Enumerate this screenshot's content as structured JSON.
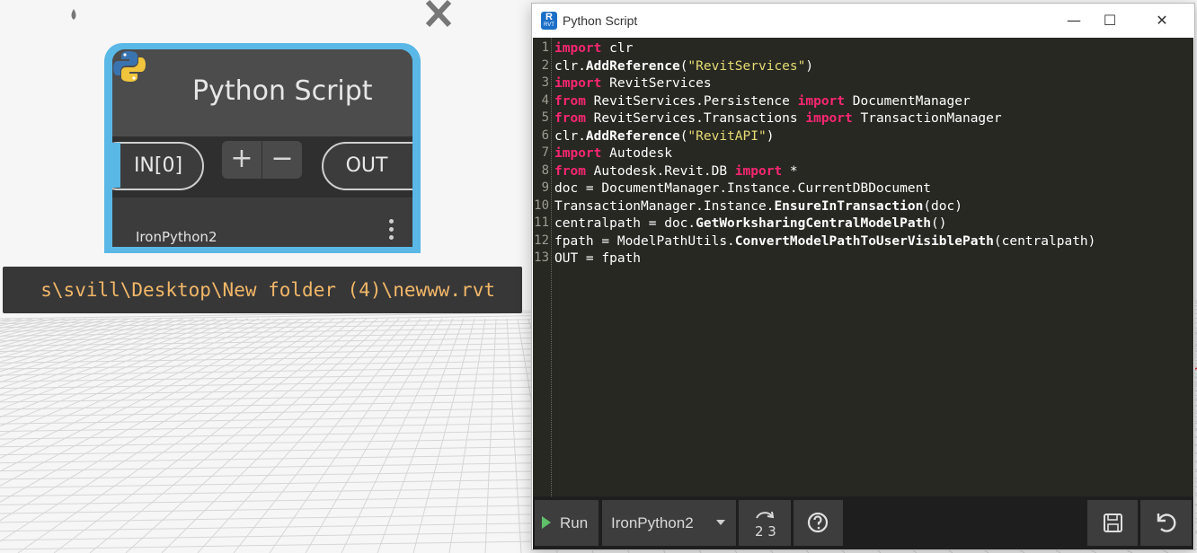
{
  "node": {
    "title": "Python Script",
    "input_port": "IN[0]",
    "add_input": "+",
    "remove_input": "−",
    "output_port": "OUT",
    "engine": "IronPython2"
  },
  "preview": {
    "value": "s\\svill\\Desktop\\New folder (4)\\newww.rvt"
  },
  "window": {
    "title": "Python Script",
    "app_badge": "R",
    "app_badge_sub": "RVT",
    "minimize": "—",
    "maximize": "☐",
    "close": "✕"
  },
  "editor": {
    "line_numbers": [
      "1",
      "2",
      "3",
      "4",
      "5",
      "6",
      "7",
      "8",
      "9",
      "10",
      "11",
      "12",
      "13"
    ],
    "lines": [
      [
        {
          "t": "import",
          "c": "kw"
        },
        {
          "t": " clr",
          "c": ""
        }
      ],
      [
        {
          "t": "clr.",
          "c": ""
        },
        {
          "t": "AddReference",
          "c": "fn"
        },
        {
          "t": "(",
          "c": ""
        },
        {
          "t": "\"RevitServices\"",
          "c": "str"
        },
        {
          "t": ")",
          "c": ""
        }
      ],
      [
        {
          "t": "import",
          "c": "kw"
        },
        {
          "t": " RevitServices",
          "c": ""
        }
      ],
      [
        {
          "t": "from",
          "c": "kw"
        },
        {
          "t": " RevitServices.Persistence ",
          "c": ""
        },
        {
          "t": "import",
          "c": "kw"
        },
        {
          "t": " DocumentManager",
          "c": ""
        }
      ],
      [
        {
          "t": "from",
          "c": "kw"
        },
        {
          "t": " RevitServices.Transactions ",
          "c": ""
        },
        {
          "t": "import",
          "c": "kw"
        },
        {
          "t": " TransactionManager",
          "c": ""
        }
      ],
      [
        {
          "t": "clr.",
          "c": ""
        },
        {
          "t": "AddReference",
          "c": "fn"
        },
        {
          "t": "(",
          "c": ""
        },
        {
          "t": "\"RevitAPI\"",
          "c": "str"
        },
        {
          "t": ")",
          "c": ""
        }
      ],
      [
        {
          "t": "import",
          "c": "kw"
        },
        {
          "t": " Autodesk",
          "c": ""
        }
      ],
      [
        {
          "t": "from",
          "c": "kw"
        },
        {
          "t": " Autodesk.Revit.DB ",
          "c": ""
        },
        {
          "t": "import",
          "c": "kw"
        },
        {
          "t": " *",
          "c": ""
        }
      ],
      [
        {
          "t": "doc = DocumentManager.Instance.CurrentDBDocument",
          "c": ""
        }
      ],
      [
        {
          "t": "TransactionManager.Instance.",
          "c": ""
        },
        {
          "t": "EnsureInTransaction",
          "c": "fn"
        },
        {
          "t": "(doc)",
          "c": ""
        }
      ],
      [
        {
          "t": "centralpath = doc.",
          "c": ""
        },
        {
          "t": "GetWorksharingCentralModelPath",
          "c": "fn"
        },
        {
          "t": "()",
          "c": ""
        }
      ],
      [
        {
          "t": "fpath = ModelPathUtils.",
          "c": ""
        },
        {
          "t": "ConvertModelPathToUserVisiblePath",
          "c": "fn"
        },
        {
          "t": "(centralpath)",
          "c": ""
        }
      ],
      [
        {
          "t": "OUT = fpath",
          "c": ""
        }
      ]
    ]
  },
  "toolbar": {
    "run_label": "Run",
    "engine_selected": "IronPython2",
    "migrate_icon": "migrate-2to3-icon",
    "migrate_digits": "2 3",
    "help_icon": "help-icon",
    "save_icon": "save-icon",
    "revert_icon": "revert-icon"
  },
  "colors": {
    "node_selected_border": "#5ab8e6",
    "editor_bg": "#272822",
    "keyword": "#f92672",
    "string": "#e6db74",
    "preview_text": "#f2b768",
    "run_green": "#5fbf6b"
  }
}
